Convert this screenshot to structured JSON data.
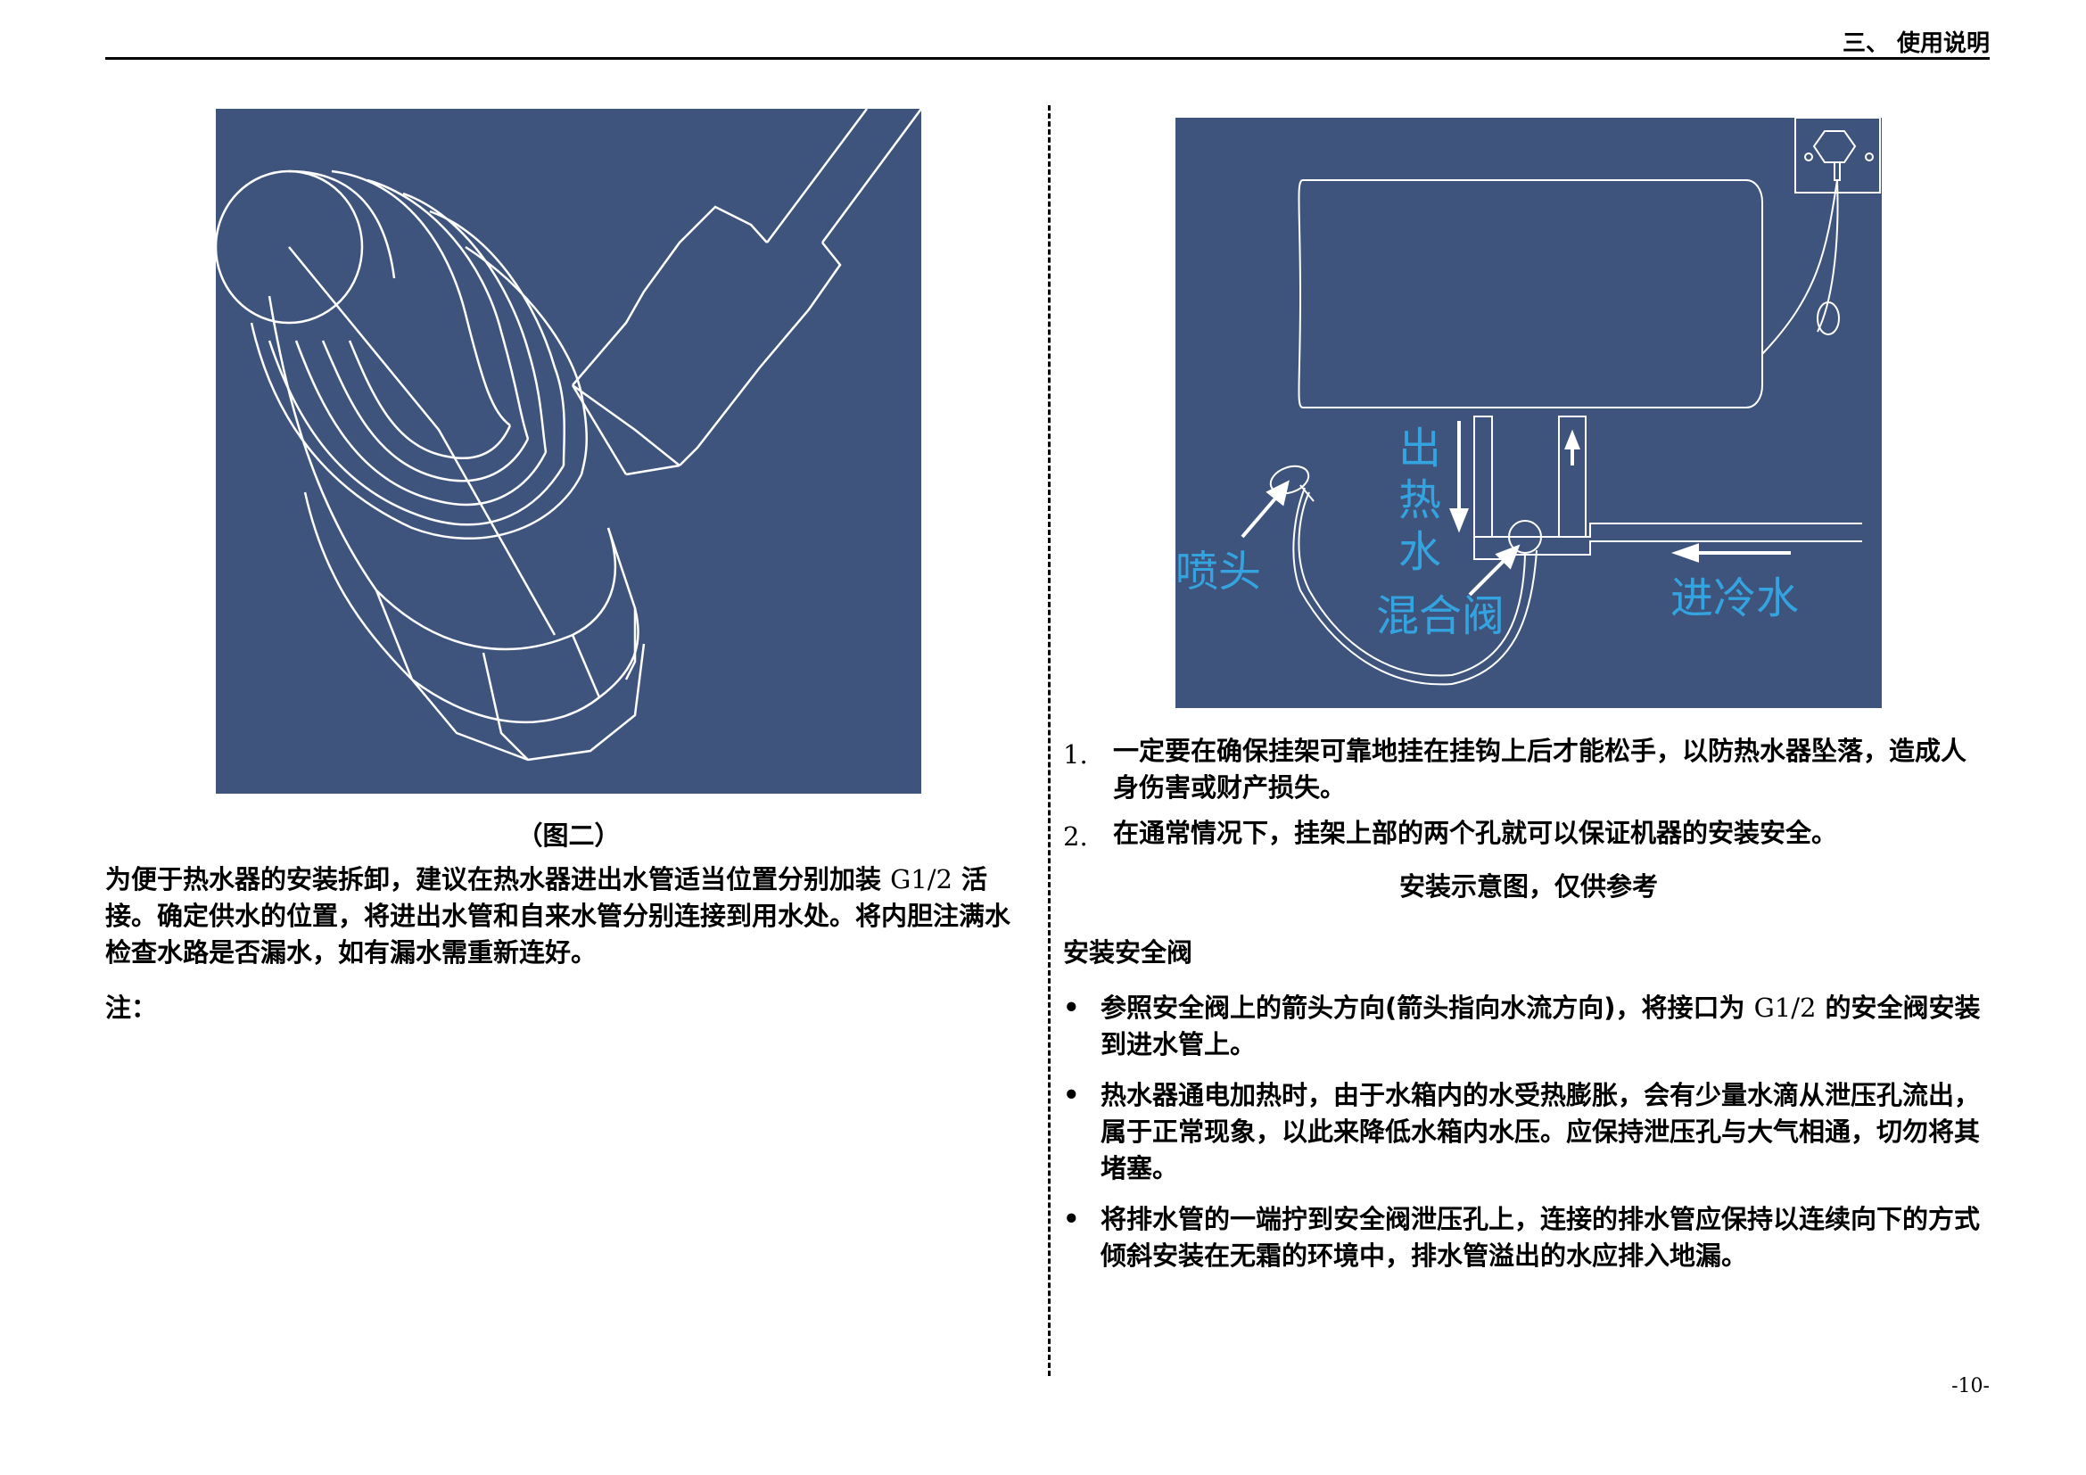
{
  "header": {
    "title": "三、 使用说明"
  },
  "left": {
    "caption": "（图二）",
    "paragraph_a": "为便于热水器的安装拆卸，建议在热水器进出水管适当位置分别加装 ",
    "paragraph_spec": "G1/2",
    "paragraph_b": " 活接。确定供水的位置，将进出水管和自来水管分别连接到用水处。将内胆注满水检查水路是否漏水，如有漏水需重新连好。",
    "note": "注："
  },
  "figure2": {
    "label_out_hot": "出热水",
    "label_nozzle": "喷头",
    "label_mixing_valve": "混合阀",
    "label_cold_in": "进冷水"
  },
  "right": {
    "ordered": [
      {
        "num": "1.",
        "text": "一定要在确保挂架可靠地挂在挂钩上后才能松手，以防热水器坠落，造成人身伤害或财产损失。"
      },
      {
        "num": "2.",
        "text": "在通常情况下，挂架上部的两个孔就可以保证机器的安装安全。"
      }
    ],
    "center_note": "安装示意图，仅供参考",
    "section_title": "安装安全阀",
    "bullet_symbol": "•",
    "bullets": [
      {
        "a": "参照安全阀上的箭头方向(箭头指向水流方向)，将接口为 ",
        "spec": "G1/2",
        "b": " 的安全阀安装到进水管上。"
      },
      {
        "a": "热水器通电加热时，由于水箱内的水受热膨胀，会有少量水滴从泄压孔流出，属于正常现象，以此来降低水箱内水压。应保持泄压孔与大气相通，切勿将其堵塞。",
        "spec": "",
        "b": ""
      },
      {
        "a": "将排水管的一端拧到安全阀泄压孔上，连接的排水管应保持以连续向下的方式倾斜安装在无霜的环境中，排水管溢出的水应排入地漏。",
        "spec": "",
        "b": ""
      }
    ]
  },
  "footer": {
    "page_number": "-10-"
  },
  "colors": {
    "panel": "#3f547d",
    "label_blue": "#33a4e0",
    "line": "#ffffff"
  }
}
